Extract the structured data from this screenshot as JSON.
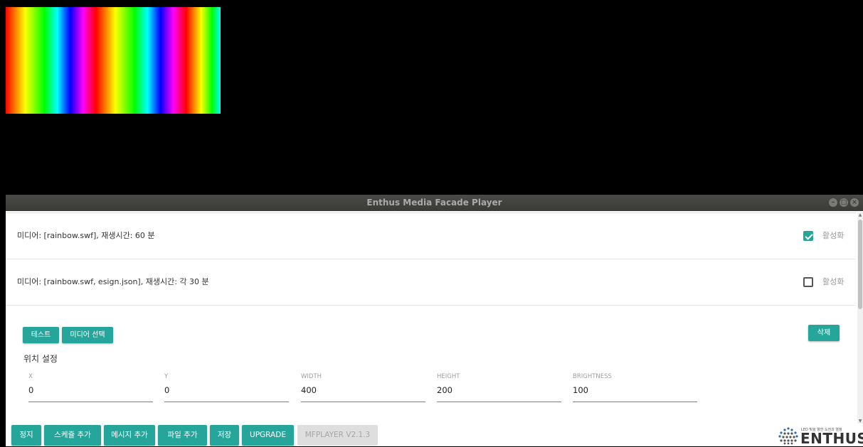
{
  "window": {
    "title": "Enthus Media Facade Player",
    "controls": [
      "minimize-icon",
      "maximize-icon",
      "close-icon"
    ]
  },
  "schedules": [
    {
      "desc": "미디어: [rainbow.swf], 재생시간: 60 분",
      "checked": true,
      "activate_label": "활성화"
    },
    {
      "desc": "미디어: [rainbow.swf, esign.json], 재생시간: 각 30 분",
      "checked": false,
      "activate_label": "활성화"
    }
  ],
  "editor": {
    "test_label": "테스트",
    "media_select_label": "미디어 선택",
    "delete_label": "삭제",
    "section_title": "위치 설정",
    "fields": [
      {
        "label": "X",
        "value": "0"
      },
      {
        "label": "Y",
        "value": "0"
      },
      {
        "label": "WIDTH",
        "value": "400"
      },
      {
        "label": "HEIGHT",
        "value": "200"
      },
      {
        "label": "BRIGHTNESS",
        "value": "100"
      }
    ]
  },
  "bottom_bar": {
    "stop_label": "정지",
    "add_schedule_label": "스케쥴 추가",
    "add_message_label": "메시지 추가",
    "add_file_label": "파일 추가",
    "save_label": "저장",
    "upgrade_label": "UPGRADE",
    "version_label": "MFPLAYER V2.1.3"
  },
  "logo": {
    "tagline": "LED 빛을 향한 도전과 열정",
    "word": "ENTHUS"
  },
  "colors": {
    "accent": "#26a69a",
    "titlebar": "#3c3c38"
  }
}
